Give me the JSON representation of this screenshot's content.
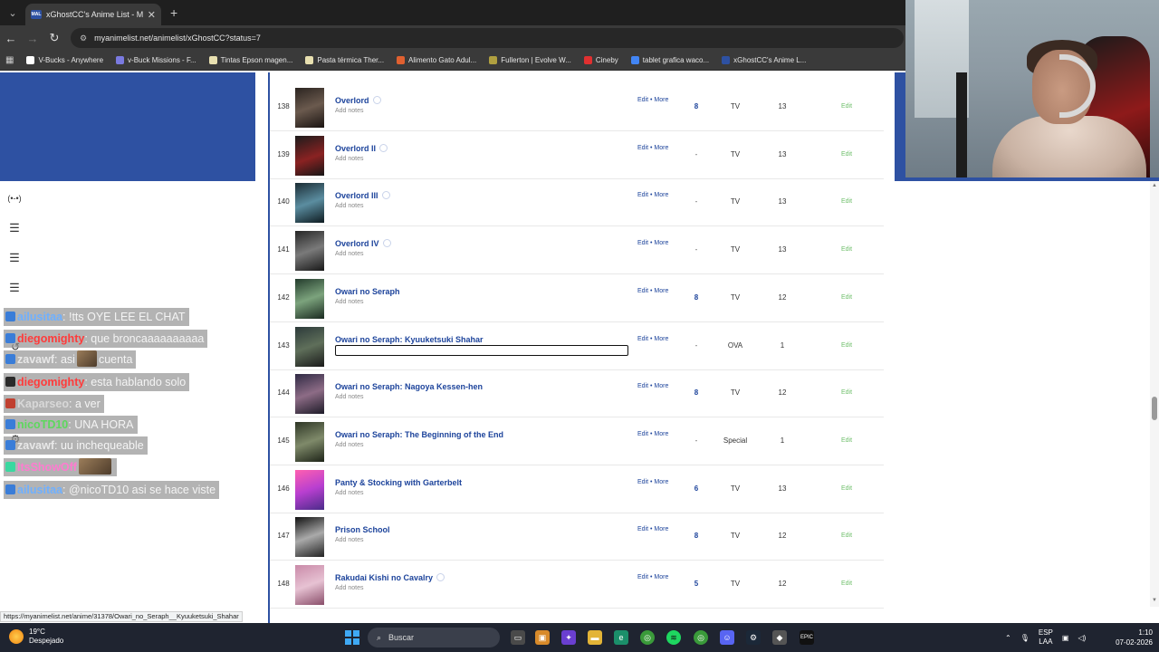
{
  "browser": {
    "tab_title": "xGhostCC's Anime List - MyAni",
    "url": "myanimelist.net/animelist/xGhostCC?status=7",
    "bookmarks": [
      {
        "label": "V-Bucks - Anywhere",
        "color": "#ffffff"
      },
      {
        "label": "v-Buck Missions - F...",
        "color": "#7a7ae0"
      },
      {
        "label": "Tintas Epson magen...",
        "color": "#e8e0b0"
      },
      {
        "label": "Pasta térmica Ther...",
        "color": "#e8e0b0"
      },
      {
        "label": "Alimento Gato Adul...",
        "color": "#e06030"
      },
      {
        "label": "Fullerton | Evolve W...",
        "color": "#b0a040"
      },
      {
        "label": "Cineby",
        "color": "#e03030"
      },
      {
        "label": "tablet grafica waco...",
        "color": "#4285f4"
      },
      {
        "label": "xGhostCC's Anime L...",
        "color": "#2e51a2"
      }
    ]
  },
  "anime_list": {
    "add_notes_label": "Add notes",
    "edit_more_label": "Edit • More",
    "edit_label": "Edit",
    "rows": [
      {
        "rank": "138",
        "title": "Overlord",
        "info": true,
        "score": "8",
        "type": "TV",
        "eps": "13",
        "thumb": "t-dark1"
      },
      {
        "rank": "139",
        "title": "Overlord II",
        "info": true,
        "score": "-",
        "type": "TV",
        "eps": "13",
        "thumb": "t-red"
      },
      {
        "rank": "140",
        "title": "Overlord III",
        "info": true,
        "score": "-",
        "type": "TV",
        "eps": "13",
        "thumb": "t-teal"
      },
      {
        "rank": "141",
        "title": "Overlord IV",
        "info": true,
        "score": "-",
        "type": "TV",
        "eps": "13",
        "thumb": "t-gray"
      },
      {
        "rank": "142",
        "title": "Owari no Seraph",
        "info": false,
        "score": "8",
        "type": "TV",
        "eps": "12",
        "thumb": "t-green"
      },
      {
        "rank": "143",
        "title": "Owari no Seraph: Kyuuketsuki Shahar",
        "info": false,
        "score": "-",
        "type": "OVA",
        "eps": "1",
        "thumb": "t-blood",
        "editing": true
      },
      {
        "rank": "144",
        "title": "Owari no Seraph: Nagoya Kessen-hen",
        "info": false,
        "score": "8",
        "type": "TV",
        "eps": "12",
        "thumb": "t-purple"
      },
      {
        "rank": "145",
        "title": "Owari no Seraph: The Beginning of the End",
        "info": false,
        "score": "-",
        "type": "Special",
        "eps": "1",
        "thumb": "t-olive"
      },
      {
        "rank": "146",
        "title": "Panty & Stocking with Garterbelt",
        "info": false,
        "score": "6",
        "type": "TV",
        "eps": "13",
        "thumb": "t-pink"
      },
      {
        "rank": "147",
        "title": "Prison School",
        "info": false,
        "score": "8",
        "type": "TV",
        "eps": "12",
        "thumb": "t-bw"
      },
      {
        "rank": "148",
        "title": "Rakudai Kishi no Cavalry",
        "info": true,
        "score": "5",
        "type": "TV",
        "eps": "12",
        "thumb": "t-rose"
      }
    ]
  },
  "chat": {
    "messages": [
      {
        "user": "ailusitaa",
        "text": "!tts OYE LEE EL CHAT",
        "user_color": "#6fb0ff"
      },
      {
        "user": "diegomighty",
        "text": "que broncaaaaaaaaaa",
        "user_color": "#ff3b3b"
      },
      {
        "user": "zavawf",
        "text": "asi",
        "after_emote": "cuenta",
        "user_color": "#e8e8e8"
      },
      {
        "user": "diegomighty",
        "text": "esta hablando solo",
        "user_color": "#ff3b3b"
      },
      {
        "user": "Kaparseo",
        "text": "a ver",
        "user_color": "#d8d8d8"
      },
      {
        "user": "nicoTD10",
        "text": "UNA HORA",
        "user_color": "#5dd85d"
      },
      {
        "user": "zavawf",
        "text": "uu inchequeable",
        "user_color": "#e8e8e8"
      },
      {
        "user": "ItsShowOff",
        "text": "",
        "user_color": "#ff7bd0"
      },
      {
        "user": "ailusitaa",
        "text": "@nicoTD10 asi se hace viste",
        "user_color": "#6fb0ff"
      }
    ]
  },
  "status_url": "https://myanimelist.net/anime/31378/Owari_no_Seraph__Kyuuketsuki_Shahar",
  "taskbar": {
    "temperature": "19°C",
    "weather": "Despejado",
    "search_placeholder": "Buscar",
    "lang_top": "ESP",
    "lang_bottom": "LAA",
    "time": "1:10",
    "date": "07-02-2026"
  }
}
